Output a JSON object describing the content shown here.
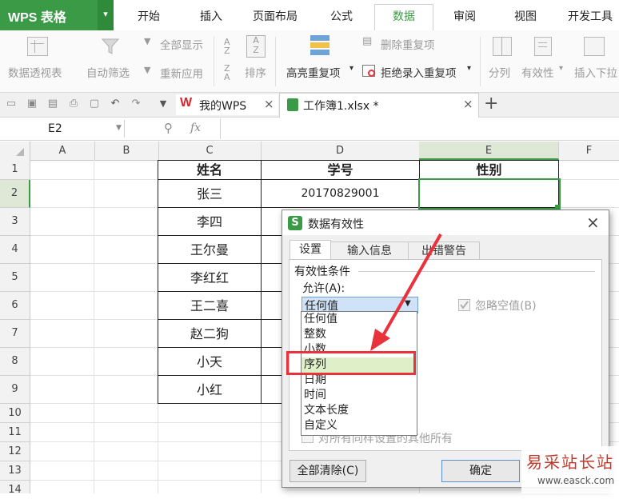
{
  "app": {
    "logo": "WPS 表格",
    "logo_arrow": "▾"
  },
  "menu": [
    "开始",
    "插入",
    "页面布局",
    "公式",
    "数据",
    "审阅",
    "视图",
    "开发工具"
  ],
  "menu_active": "数据",
  "ribbon": {
    "pivot": "数据透视表",
    "autofilter": "自动筛选",
    "show_all": "全部显示",
    "reapply": "重新应用",
    "sort_asc_icon": "A↓Z",
    "sort": "排序",
    "highlight_dup": "高亮重复项",
    "highlight_dup_arrow": "▾",
    "remove_dup": "删除重复项",
    "reject_dup": "拒绝录入重复项",
    "reject_dup_arrow": "▾",
    "split": "分列",
    "validity": "有效性",
    "validity_arrow": "▾",
    "insert_dropdown": "插入下拉"
  },
  "tabs": [
    {
      "label": "我的WPS",
      "close": "×"
    },
    {
      "label": "工作簿1.xlsx *",
      "close": "×"
    }
  ],
  "tab_add": "+",
  "namebox": "E2",
  "formula_icons": {
    "zoom": "⚲",
    "fx": "fx"
  },
  "columns": [
    "A",
    "B",
    "C",
    "D",
    "E",
    "F"
  ],
  "rows": [
    "1",
    "2",
    "3",
    "4",
    "5",
    "6",
    "7",
    "8",
    "9",
    "10",
    "11",
    "12",
    "13",
    "14"
  ],
  "table": {
    "headers": [
      "姓名",
      "学号",
      "性别"
    ],
    "names": [
      "张三",
      "李四",
      "王尔曼",
      "李红红",
      "王二喜",
      "赵二狗",
      "小天",
      "小红"
    ],
    "id_row2": "20170829001"
  },
  "dialog": {
    "title": "数据有效性",
    "close": "×",
    "tabs": [
      "设置",
      "输入信息",
      "出错警告"
    ],
    "section": "有效性条件",
    "allow_label": "允许(A):",
    "allow_value": "任何值",
    "options": [
      "任何值",
      "整数",
      "小数",
      "序列",
      "日期",
      "时间",
      "文本长度",
      "自定义"
    ],
    "selected": "序列",
    "ignore_blank": "忽略空值(B)",
    "apply_all": "对所有同样设置的其他所有",
    "clear_all": "全部清除(C)",
    "ok": "确定"
  },
  "watermark": {
    "cn": "易采站长站",
    "url": "www.easck.com"
  },
  "colors": {
    "brand": "#3b9a45",
    "highlight_red": "#e8323c",
    "select_green": "#dff0c8"
  }
}
